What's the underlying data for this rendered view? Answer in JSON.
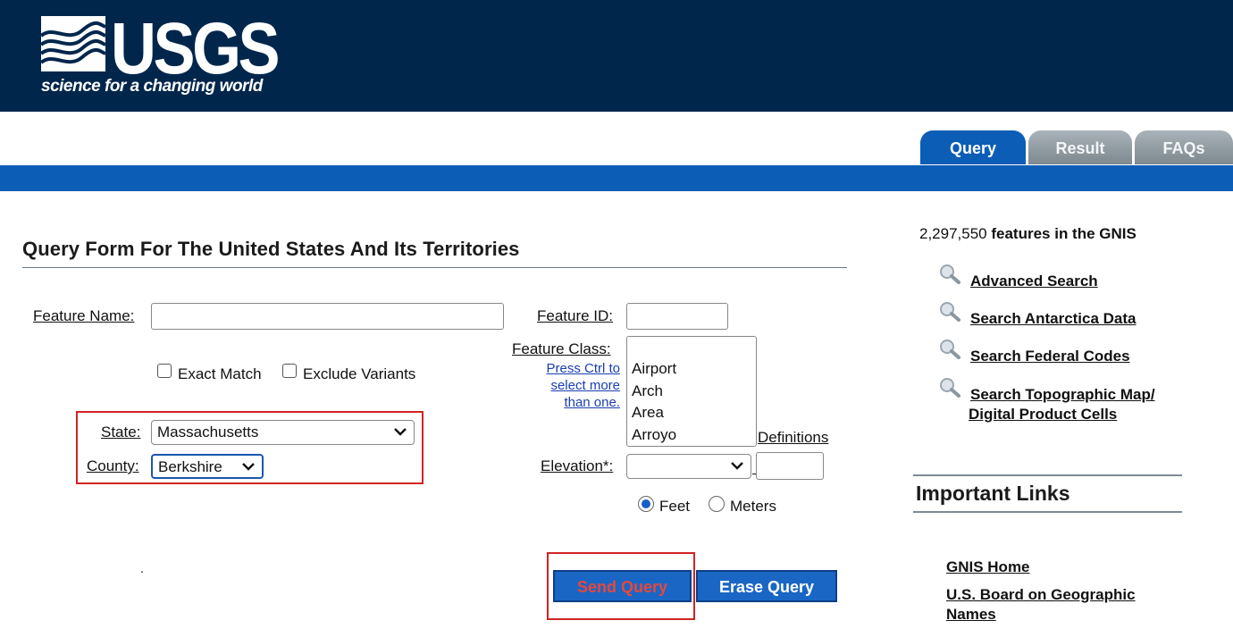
{
  "header": {
    "logo_text": "USGS",
    "logo_tagline": "science for a changing world",
    "logo_icon": "usgs-wave-icon",
    "background_color": "#00264c"
  },
  "tabs": [
    {
      "label": "Query",
      "active": true
    },
    {
      "label": "Result",
      "active": false
    },
    {
      "label": "FAQs",
      "active": false
    }
  ],
  "form": {
    "title": "Query Form For The United States And Its Territories",
    "feature_name_label": "Feature Name:",
    "feature_name_value": "",
    "exact_match_label": "Exact Match",
    "exclude_variants_label": "Exclude Variants",
    "state_label": "State:",
    "state_value": "Massachusetts",
    "county_label": "County:",
    "county_value": "Berkshire",
    "feature_id_label": "Feature ID:",
    "feature_id_value": "",
    "feature_class_label": "Feature Class:",
    "feature_class_hint": [
      "Press Ctrl to",
      "select more",
      "than one."
    ],
    "feature_class_options": [
      "Airport",
      "Arch",
      "Area",
      "Arroyo"
    ],
    "definitions_link": "Definitions",
    "elevation_label": "Elevation*:",
    "elevation_value": "",
    "elevation_text_value": "",
    "unit_feet": "Feet",
    "unit_meters": "Meters",
    "unit_selected": "Feet",
    "send_query": "Send Query",
    "erase_query": "Erase Query",
    "dot": "."
  },
  "sidebar": {
    "count_number": "2,297,550",
    "count_suffix": " features in the GNIS",
    "links": [
      {
        "label": "Advanced Search"
      },
      {
        "label": "Search Antarctica Data"
      },
      {
        "label": "Search Federal Codes"
      },
      {
        "label": "Search Topographic Map/",
        "label2": "Digital Product Cells"
      }
    ],
    "important_links_title": "Important Links",
    "important_links": [
      "GNIS Home",
      "U.S. Board on Geographic",
      "Names"
    ]
  },
  "colors": {
    "header_navy": "#00264c",
    "tab_blue": "#0c5db5",
    "highlight_red": "#d12323",
    "send_text": "#e8473c"
  }
}
